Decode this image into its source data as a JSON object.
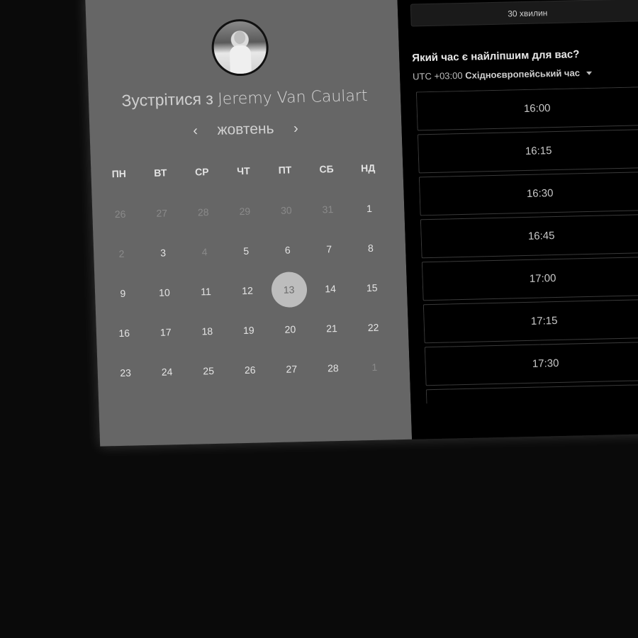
{
  "host": {
    "prefix": "Зустрітися з",
    "name": "Jeremy Van Caulart"
  },
  "calendar": {
    "month": "жовтень",
    "prev_icon": "chevron-left-icon",
    "next_icon": "chevron-right-icon",
    "weekdays": [
      "ПН",
      "ВТ",
      "СР",
      "ЧТ",
      "ПТ",
      "СБ",
      "НД"
    ],
    "days": [
      {
        "d": "26",
        "muted": true
      },
      {
        "d": "27",
        "muted": true
      },
      {
        "d": "28",
        "muted": true
      },
      {
        "d": "29",
        "muted": true
      },
      {
        "d": "30",
        "muted": true
      },
      {
        "d": "31",
        "muted": true
      },
      {
        "d": "1",
        "muted": false
      },
      {
        "d": "2",
        "muted": true
      },
      {
        "d": "3",
        "muted": false
      },
      {
        "d": "4",
        "muted": true
      },
      {
        "d": "5",
        "muted": false
      },
      {
        "d": "6",
        "muted": false
      },
      {
        "d": "7",
        "muted": false
      },
      {
        "d": "8",
        "muted": false
      },
      {
        "d": "9",
        "muted": false
      },
      {
        "d": "10",
        "muted": false
      },
      {
        "d": "11",
        "muted": false
      },
      {
        "d": "12",
        "muted": false
      },
      {
        "d": "13",
        "muted": false,
        "selected": true
      },
      {
        "d": "14",
        "muted": false
      },
      {
        "d": "15",
        "muted": false
      },
      {
        "d": "16",
        "muted": false
      },
      {
        "d": "17",
        "muted": false
      },
      {
        "d": "18",
        "muted": false
      },
      {
        "d": "19",
        "muted": false
      },
      {
        "d": "20",
        "muted": false
      },
      {
        "d": "21",
        "muted": false
      },
      {
        "d": "22",
        "muted": false
      },
      {
        "d": "23",
        "muted": false
      },
      {
        "d": "24",
        "muted": false
      },
      {
        "d": "25",
        "muted": false
      },
      {
        "d": "26",
        "muted": false
      },
      {
        "d": "27",
        "muted": false
      },
      {
        "d": "28",
        "muted": false
      },
      {
        "d": "1",
        "muted": true
      }
    ]
  },
  "booking": {
    "duration": "30 хвилин",
    "question": "Який час є найліпшим для вас?",
    "tz_offset": "UTC +03:00",
    "tz_name": "Східноєвропейський час",
    "slots": [
      "16:00",
      "16:15",
      "16:30",
      "16:45",
      "17:00",
      "17:15",
      "17:30",
      ""
    ]
  }
}
